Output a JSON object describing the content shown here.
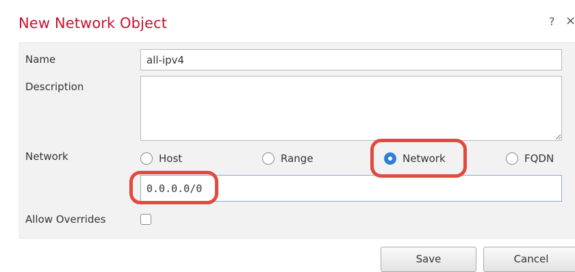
{
  "dialog": {
    "title": "New Network Object",
    "help_glyph": "?",
    "close_glyph": "×"
  },
  "form": {
    "name_label": "Name",
    "name_value": "all-ipv4",
    "description_label": "Description",
    "description_value": "",
    "network_label": "Network",
    "network_options": [
      {
        "label": "Host",
        "checked": false
      },
      {
        "label": "Range",
        "checked": false
      },
      {
        "label": "Network",
        "checked": true
      },
      {
        "label": "FQDN",
        "checked": false
      }
    ],
    "network_value": "0.0.0.0/0",
    "allow_overrides_label": "Allow Overrides",
    "allow_overrides_checked": false
  },
  "buttons": {
    "save_label": "Save",
    "cancel_label": "Cancel"
  },
  "colors": {
    "title": "#c8102e",
    "highlight": "#e14a3d",
    "radio_selected": "#2f7fd6",
    "panel_bg": "#f2f2f2"
  }
}
